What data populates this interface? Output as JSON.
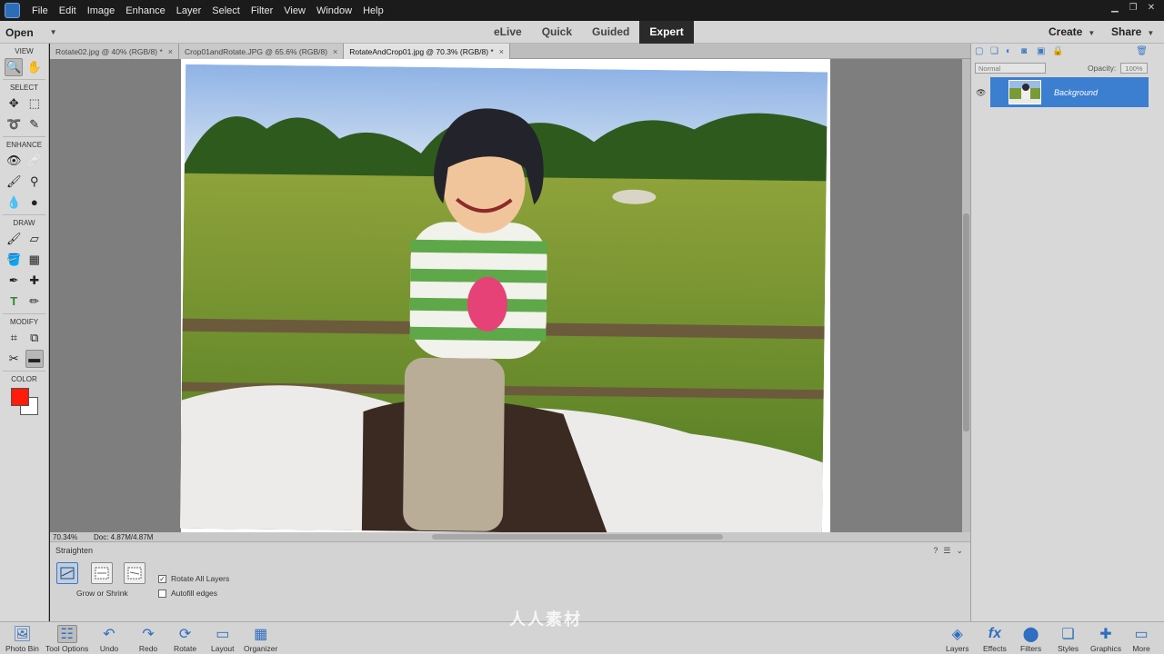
{
  "menu": [
    "File",
    "Edit",
    "Image",
    "Enhance",
    "Layer",
    "Select",
    "Filter",
    "View",
    "Window",
    "Help"
  ],
  "modebar": {
    "open": "Open",
    "modes": [
      "eLive",
      "Quick",
      "Guided",
      "Expert"
    ],
    "active_mode": "Expert",
    "create": "Create",
    "share": "Share"
  },
  "toolbox": {
    "sections": [
      "VIEW",
      "SELECT",
      "ENHANCE",
      "DRAW",
      "MODIFY",
      "COLOR"
    ],
    "foreground": "#ff1c0a",
    "background": "#ffffff"
  },
  "tabs": [
    {
      "label": "Rotate02.jpg @ 40% (RGB/8) *",
      "close": "×"
    },
    {
      "label": "Crop01andRotate.JPG @ 65.6% (RGB/8)",
      "close": "×"
    },
    {
      "label": "RotateAndCrop01.jpg @ 70.3% (RGB/8) *",
      "close": "×"
    }
  ],
  "status": {
    "zoom": "70.34%",
    "doc": "Doc: 4.87M/4.87M"
  },
  "tool_options": {
    "title": "Straighten",
    "mode_label": "Grow or Shrink",
    "rotate_all_layers": "Rotate All Layers",
    "rotate_all_layers_checked": true,
    "autofill_edges": "Autofill edges",
    "autofill_edges_checked": false
  },
  "layers_panel": {
    "blend_mode": "Normal",
    "opacity_label": "Opacity:",
    "opacity_value": "100%",
    "layer_name": "Background"
  },
  "taskbar": {
    "left": [
      "Photo Bin",
      "Tool Options",
      "Undo",
      "Redo",
      "Rotate",
      "Layout",
      "Organizer"
    ],
    "right": [
      "Layers",
      "Effects",
      "Filters",
      "Styles",
      "Graphics",
      "More"
    ]
  },
  "watermark": "人人素材"
}
